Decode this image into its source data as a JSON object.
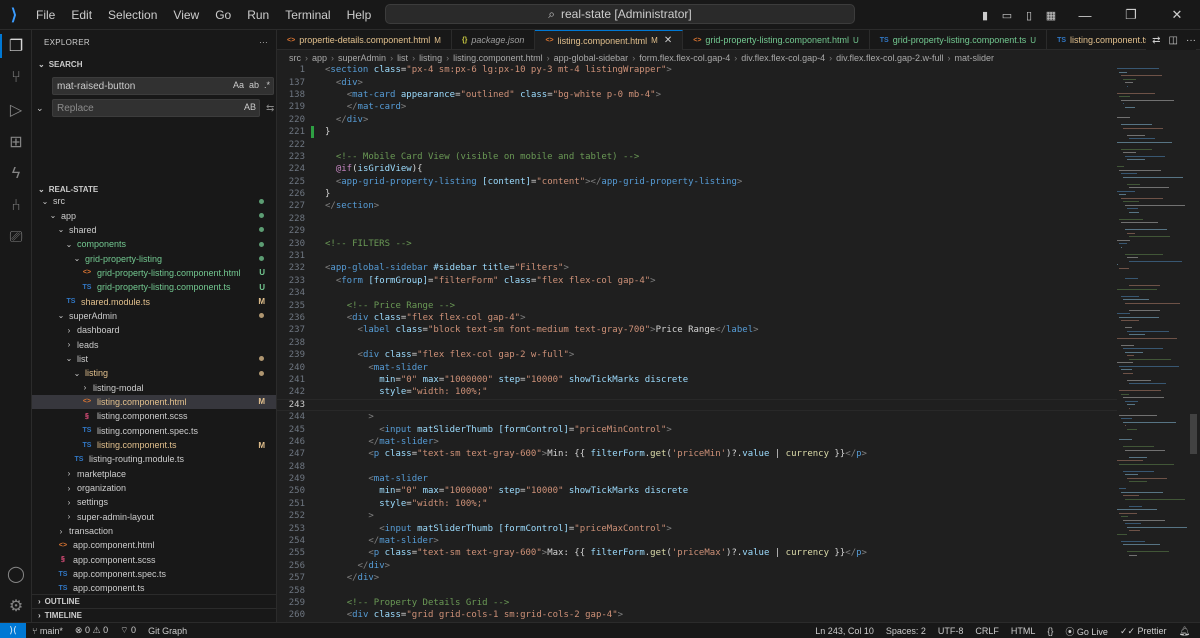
{
  "menu": [
    "File",
    "Edit",
    "Selection",
    "View",
    "Go",
    "Run",
    "Terminal",
    "Help"
  ],
  "window_title": "real-state [Administrator]",
  "explorer": {
    "header": "EXPLORER",
    "search_header": "SEARCH",
    "search_value": "mat-raised-button",
    "search_opts": [
      "Aa",
      "ab",
      ".*"
    ],
    "replace_placeholder": "Replace",
    "replace_button": "AB",
    "project_name": "REAL-STATE",
    "tree": [
      {
        "label": "src",
        "depth": 0,
        "chev": "⌄",
        "type": "folder",
        "dot": "#73c991",
        "color": "#cccccc"
      },
      {
        "label": "app",
        "depth": 1,
        "chev": "⌄",
        "type": "folder",
        "dot": "#73c991",
        "color": "#cccccc"
      },
      {
        "label": "shared",
        "depth": 2,
        "chev": "⌄",
        "type": "folder",
        "dot": "#73c991",
        "color": "#cccccc"
      },
      {
        "label": "components",
        "depth": 3,
        "chev": "⌄",
        "type": "folder",
        "dot": "#73c991",
        "color": "#73c991"
      },
      {
        "label": "grid-property-listing",
        "depth": 4,
        "chev": "⌄",
        "type": "folder",
        "dot": "#73c991",
        "color": "#73c991"
      },
      {
        "label": "grid-property-listing.component.html",
        "depth": 5,
        "type": "html",
        "status": "U",
        "color": "#73c991"
      },
      {
        "label": "grid-property-listing.component.ts",
        "depth": 5,
        "type": "ts",
        "status": "U",
        "color": "#73c991"
      },
      {
        "label": "shared.module.ts",
        "depth": 3,
        "type": "ts",
        "status": "M",
        "color": "#e2c08d"
      },
      {
        "label": "superAdmin",
        "depth": 2,
        "chev": "⌄",
        "type": "folder",
        "dot": "#e2c08d",
        "color": "#cccccc"
      },
      {
        "label": "dashboard",
        "depth": 3,
        "chev": "›",
        "type": "folder",
        "color": "#cccccc"
      },
      {
        "label": "leads",
        "depth": 3,
        "chev": "›",
        "type": "folder",
        "color": "#cccccc"
      },
      {
        "label": "list",
        "depth": 3,
        "chev": "⌄",
        "type": "folder",
        "dot": "#e2c08d",
        "color": "#cccccc"
      },
      {
        "label": "listing",
        "depth": 4,
        "chev": "⌄",
        "type": "folder",
        "dot": "#e2c08d",
        "color": "#e2c08d"
      },
      {
        "label": "listing-modal",
        "depth": 5,
        "chev": "›",
        "type": "folder",
        "color": "#cccccc"
      },
      {
        "label": "listing.component.html",
        "depth": 5,
        "type": "html",
        "status": "M",
        "color": "#e2c08d",
        "selected": true
      },
      {
        "label": "listing.component.scss",
        "depth": 5,
        "type": "scss",
        "color": "#cccccc"
      },
      {
        "label": "listing.component.spec.ts",
        "depth": 5,
        "type": "ts",
        "color": "#cccccc"
      },
      {
        "label": "listing.component.ts",
        "depth": 5,
        "type": "ts",
        "status": "M",
        "color": "#e2c08d"
      },
      {
        "label": "listing-routing.module.ts",
        "depth": 4,
        "type": "ts",
        "color": "#cccccc"
      },
      {
        "label": "marketplace",
        "depth": 3,
        "chev": "›",
        "type": "folder",
        "color": "#cccccc"
      },
      {
        "label": "organization",
        "depth": 3,
        "chev": "›",
        "type": "folder",
        "color": "#cccccc"
      },
      {
        "label": "settings",
        "depth": 3,
        "chev": "›",
        "type": "folder",
        "color": "#cccccc"
      },
      {
        "label": "super-admin-layout",
        "depth": 3,
        "chev": "›",
        "type": "folder",
        "color": "#cccccc"
      },
      {
        "label": "transaction",
        "depth": 2,
        "chev": "›",
        "type": "folder",
        "color": "#cccccc"
      },
      {
        "label": "app.component.html",
        "depth": 2,
        "type": "html",
        "color": "#cccccc"
      },
      {
        "label": "app.component.scss",
        "depth": 2,
        "type": "scss",
        "color": "#cccccc"
      },
      {
        "label": "app.component.spec.ts",
        "depth": 2,
        "type": "ts",
        "color": "#cccccc"
      },
      {
        "label": "app.component.ts",
        "depth": 2,
        "type": "ts",
        "color": "#cccccc"
      }
    ],
    "outline": "OUTLINE",
    "timeline": "TIMELINE"
  },
  "tabs": [
    {
      "label": "propertie-details.component.html",
      "icon": "html",
      "status": "M",
      "statusColor": "#e2c08d",
      "labelColor": "#e2c08d"
    },
    {
      "label": "package.json",
      "icon": "json",
      "status": "",
      "statusColor": "",
      "labelColor": "#9d9d9d",
      "italic": true
    },
    {
      "label": "listing.component.html",
      "icon": "html",
      "status": "M",
      "statusColor": "#e2c08d",
      "labelColor": "#e2c08d",
      "active": true
    },
    {
      "label": "grid-property-listing.component.html",
      "icon": "html",
      "status": "U",
      "statusColor": "#73c991",
      "labelColor": "#73c991"
    },
    {
      "label": "grid-property-listing.component.ts",
      "icon": "ts",
      "status": "U",
      "statusColor": "#73c991",
      "labelColor": "#73c991"
    },
    {
      "label": "listing.component.ts",
      "icon": "ts",
      "status": "",
      "statusColor": "",
      "labelColor": "#e2c08d"
    }
  ],
  "breadcrumb": [
    "src",
    "app",
    "superAdmin",
    "list",
    "listing",
    "listing.component.html",
    "app-global-sidebar",
    "form.flex.flex-col.gap-4",
    "div.flex.flex-col.gap-4",
    "div.flex.flex-col.gap-2.w-full",
    "mat-slider"
  ],
  "code_lines": [
    {
      "n": "1",
      "mark": "",
      "html": "<span class='p'>&lt;</span><span class='t'>section</span> <span class='a'>class</span><span class='o'>=</span><span class='s'>\"px-4 sm:px-6 lg:px-10 py-3 mt-4 listingWrapper\"</span><span class='p'>&gt;</span>"
    },
    {
      "n": "137",
      "mark": "",
      "html": "  <span class='p'>&lt;</span><span class='t'>div</span><span class='p'>&gt;</span>"
    },
    {
      "n": "138",
      "mark": "",
      "html": "    <span class='p'>&lt;</span><span class='t'>mat-card</span> <span class='a'>appearance</span><span class='o'>=</span><span class='s'>\"outlined\"</span> <span class='a'>class</span><span class='o'>=</span><span class='s'>\"bg-white p-0 mb-4\"</span><span class='p'>&gt;</span>"
    },
    {
      "n": "219",
      "mark": "",
      "html": "    <span class='p'>&lt;/</span><span class='t'>mat-card</span><span class='p'>&gt;</span>"
    },
    {
      "n": "220",
      "mark": "",
      "html": "  <span class='p'>&lt;/</span><span class='t'>div</span><span class='p'>&gt;</span>"
    },
    {
      "n": "221",
      "mark": "m",
      "html": "}"
    },
    {
      "n": "222",
      "mark": "",
      "html": ""
    },
    {
      "n": "223",
      "mark": "",
      "html": "  <span class='c'>&lt;!-- Mobile Card View (visible on mobile and tablet) --&gt;</span>"
    },
    {
      "n": "224",
      "mark": "",
      "html": "  <span class='k'>@if</span>(<span class='a'>isGridView</span>){"
    },
    {
      "n": "225",
      "mark": "",
      "html": "  <span class='p'>&lt;</span><span class='t'>app-grid-property-listing</span> <span class='a'>[content]</span><span class='o'>=</span><span class='s'>\"content\"</span><span class='p'>&gt;&lt;/</span><span class='t'>app-grid-property-listing</span><span class='p'>&gt;</span>"
    },
    {
      "n": "226",
      "mark": "",
      "html": "}"
    },
    {
      "n": "227",
      "mark": "",
      "html": "<span class='p'>&lt;/</span><span class='t'>section</span><span class='p'>&gt;</span>"
    },
    {
      "n": "228",
      "mark": "",
      "html": ""
    },
    {
      "n": "229",
      "mark": "",
      "html": ""
    },
    {
      "n": "230",
      "mark": "",
      "html": "<span class='c'>&lt;!-- FILTERS --&gt;</span>"
    },
    {
      "n": "231",
      "mark": "",
      "html": ""
    },
    {
      "n": "232",
      "mark": "",
      "html": "<span class='p'>&lt;</span><span class='t'>app-global-sidebar</span> <span class='a'>#sidebar</span> <span class='a'>title</span><span class='o'>=</span><span class='s'>\"Filters\"</span><span class='p'>&gt;</span>"
    },
    {
      "n": "233",
      "mark": "",
      "html": "  <span class='p'>&lt;</span><span class='t'>form</span> <span class='a'>[formGroup]</span><span class='o'>=</span><span class='s'>\"filterForm\"</span> <span class='a'>class</span><span class='o'>=</span><span class='s'>\"flex flex-col gap-4\"</span><span class='p'>&gt;</span>"
    },
    {
      "n": "234",
      "mark": "",
      "html": ""
    },
    {
      "n": "235",
      "mark": "",
      "html": "    <span class='c'>&lt;!-- Price Range --&gt;</span>"
    },
    {
      "n": "236",
      "mark": "",
      "html": "    <span class='p'>&lt;</span><span class='t'>div</span> <span class='a'>class</span><span class='o'>=</span><span class='s'>\"flex flex-col gap-4\"</span><span class='p'>&gt;</span>"
    },
    {
      "n": "237",
      "mark": "",
      "html": "      <span class='p'>&lt;</span><span class='t'>label</span> <span class='a'>class</span><span class='o'>=</span><span class='s'>\"block text-sm font-medium text-gray-700\"</span><span class='p'>&gt;</span>Price Range<span class='p'>&lt;/</span><span class='t'>label</span><span class='p'>&gt;</span>"
    },
    {
      "n": "238",
      "mark": "",
      "html": ""
    },
    {
      "n": "239",
      "mark": "",
      "html": "      <span class='p'>&lt;</span><span class='t'>div</span> <span class='a'>class</span><span class='o'>=</span><span class='s'>\"flex flex-col gap-2 w-full\"</span><span class='p'>&gt;</span>"
    },
    {
      "n": "240",
      "mark": "",
      "html": "        <span class='p'>&lt;</span><span class='t'>mat-slider</span>"
    },
    {
      "n": "241",
      "mark": "",
      "html": "          <span class='a'>min</span><span class='o'>=</span><span class='s'>\"0\"</span> <span class='a'>max</span><span class='o'>=</span><span class='s'>\"1000000\"</span> <span class='a'>step</span><span class='o'>=</span><span class='s'>\"10000\"</span> <span class='a'>showTickMarks</span> <span class='a'>discrete</span>"
    },
    {
      "n": "242",
      "mark": "",
      "html": "          <span class='a'>style</span><span class='o'>=</span><span class='s'>\"width: 100%;\"</span>"
    },
    {
      "n": "243",
      "mark": "",
      "html": "",
      "current": true
    },
    {
      "n": "244",
      "mark": "",
      "html": "        <span class='p'>&gt;</span>"
    },
    {
      "n": "245",
      "mark": "",
      "html": "          <span class='p'>&lt;</span><span class='t'>input</span> <span class='a'>matSliderThumb</span> <span class='a'>[formControl]</span><span class='o'>=</span><span class='s'>\"priceMinControl\"</span><span class='p'>&gt;</span>"
    },
    {
      "n": "246",
      "mark": "",
      "html": "        <span class='p'>&lt;/</span><span class='t'>mat-slider</span><span class='p'>&gt;</span>"
    },
    {
      "n": "247",
      "mark": "",
      "html": "        <span class='p'>&lt;</span><span class='t'>p</span> <span class='a'>class</span><span class='o'>=</span><span class='s'>\"text-sm text-gray-600\"</span><span class='p'>&gt;</span>Min: {{ <span class='a'>filterForm</span>.<span class='f'>get</span>(<span class='s'>'priceMin'</span>)?.<span class='a'>value</span> | <span class='f'>currency</span> }}<span class='p'>&lt;/</span><span class='t'>p</span><span class='p'>&gt;</span>"
    },
    {
      "n": "248",
      "mark": "",
      "html": ""
    },
    {
      "n": "249",
      "mark": "",
      "html": "        <span class='p'>&lt;</span><span class='t'>mat-slider</span>"
    },
    {
      "n": "250",
      "mark": "",
      "html": "          <span class='a'>min</span><span class='o'>=</span><span class='s'>\"0\"</span> <span class='a'>max</span><span class='o'>=</span><span class='s'>\"1000000\"</span> <span class='a'>step</span><span class='o'>=</span><span class='s'>\"10000\"</span> <span class='a'>showTickMarks</span> <span class='a'>discrete</span>"
    },
    {
      "n": "251",
      "mark": "",
      "html": "          <span class='a'>style</span><span class='o'>=</span><span class='s'>\"width: 100%;\"</span>"
    },
    {
      "n": "252",
      "mark": "",
      "html": "        <span class='p'>&gt;</span>"
    },
    {
      "n": "253",
      "mark": "",
      "html": "          <span class='p'>&lt;</span><span class='t'>input</span> <span class='a'>matSliderThumb</span> <span class='a'>[formControl]</span><span class='o'>=</span><span class='s'>\"priceMaxControl\"</span><span class='p'>&gt;</span>"
    },
    {
      "n": "254",
      "mark": "",
      "html": "        <span class='p'>&lt;/</span><span class='t'>mat-slider</span><span class='p'>&gt;</span>"
    },
    {
      "n": "255",
      "mark": "",
      "html": "        <span class='p'>&lt;</span><span class='t'>p</span> <span class='a'>class</span><span class='o'>=</span><span class='s'>\"text-sm text-gray-600\"</span><span class='p'>&gt;</span>Max: {{ <span class='a'>filterForm</span>.<span class='f'>get</span>(<span class='s'>'priceMax'</span>)?.<span class='a'>value</span> | <span class='f'>currency</span> }}<span class='p'>&lt;/</span><span class='t'>p</span><span class='p'>&gt;</span>"
    },
    {
      "n": "256",
      "mark": "",
      "html": "      <span class='p'>&lt;/</span><span class='t'>div</span><span class='p'>&gt;</span>"
    },
    {
      "n": "257",
      "mark": "",
      "html": "    <span class='p'>&lt;/</span><span class='t'>div</span><span class='p'>&gt;</span>"
    },
    {
      "n": "258",
      "mark": "",
      "html": ""
    },
    {
      "n": "259",
      "mark": "",
      "html": "    <span class='c'>&lt;!-- Property Details Grid --&gt;</span>"
    },
    {
      "n": "260",
      "mark": "",
      "html": "    <span class='p'>&lt;</span><span class='t'>div</span> <span class='a'>class</span><span class='o'>=</span><span class='s'>\"grid grid-cols-1 sm:grid-cols-2 gap-4\"</span><span class='p'>&gt;</span>"
    },
    {
      "n": "260",
      "mark": "m",
      "html": ""
    }
  ],
  "status": {
    "branch": "main*",
    "errors": "0",
    "warnings": "0",
    "ports": "0",
    "git_graph": "Git Graph",
    "position": "Ln 243, Col 10",
    "spaces": "Spaces: 2",
    "encoding": "UTF-8",
    "eol": "CRLF",
    "language": "HTML",
    "golive": "Go Live",
    "prettier": "Prettier"
  },
  "colors": {
    "accent": "#0078d4",
    "modified": "#e2c08d",
    "untracked": "#73c991"
  }
}
